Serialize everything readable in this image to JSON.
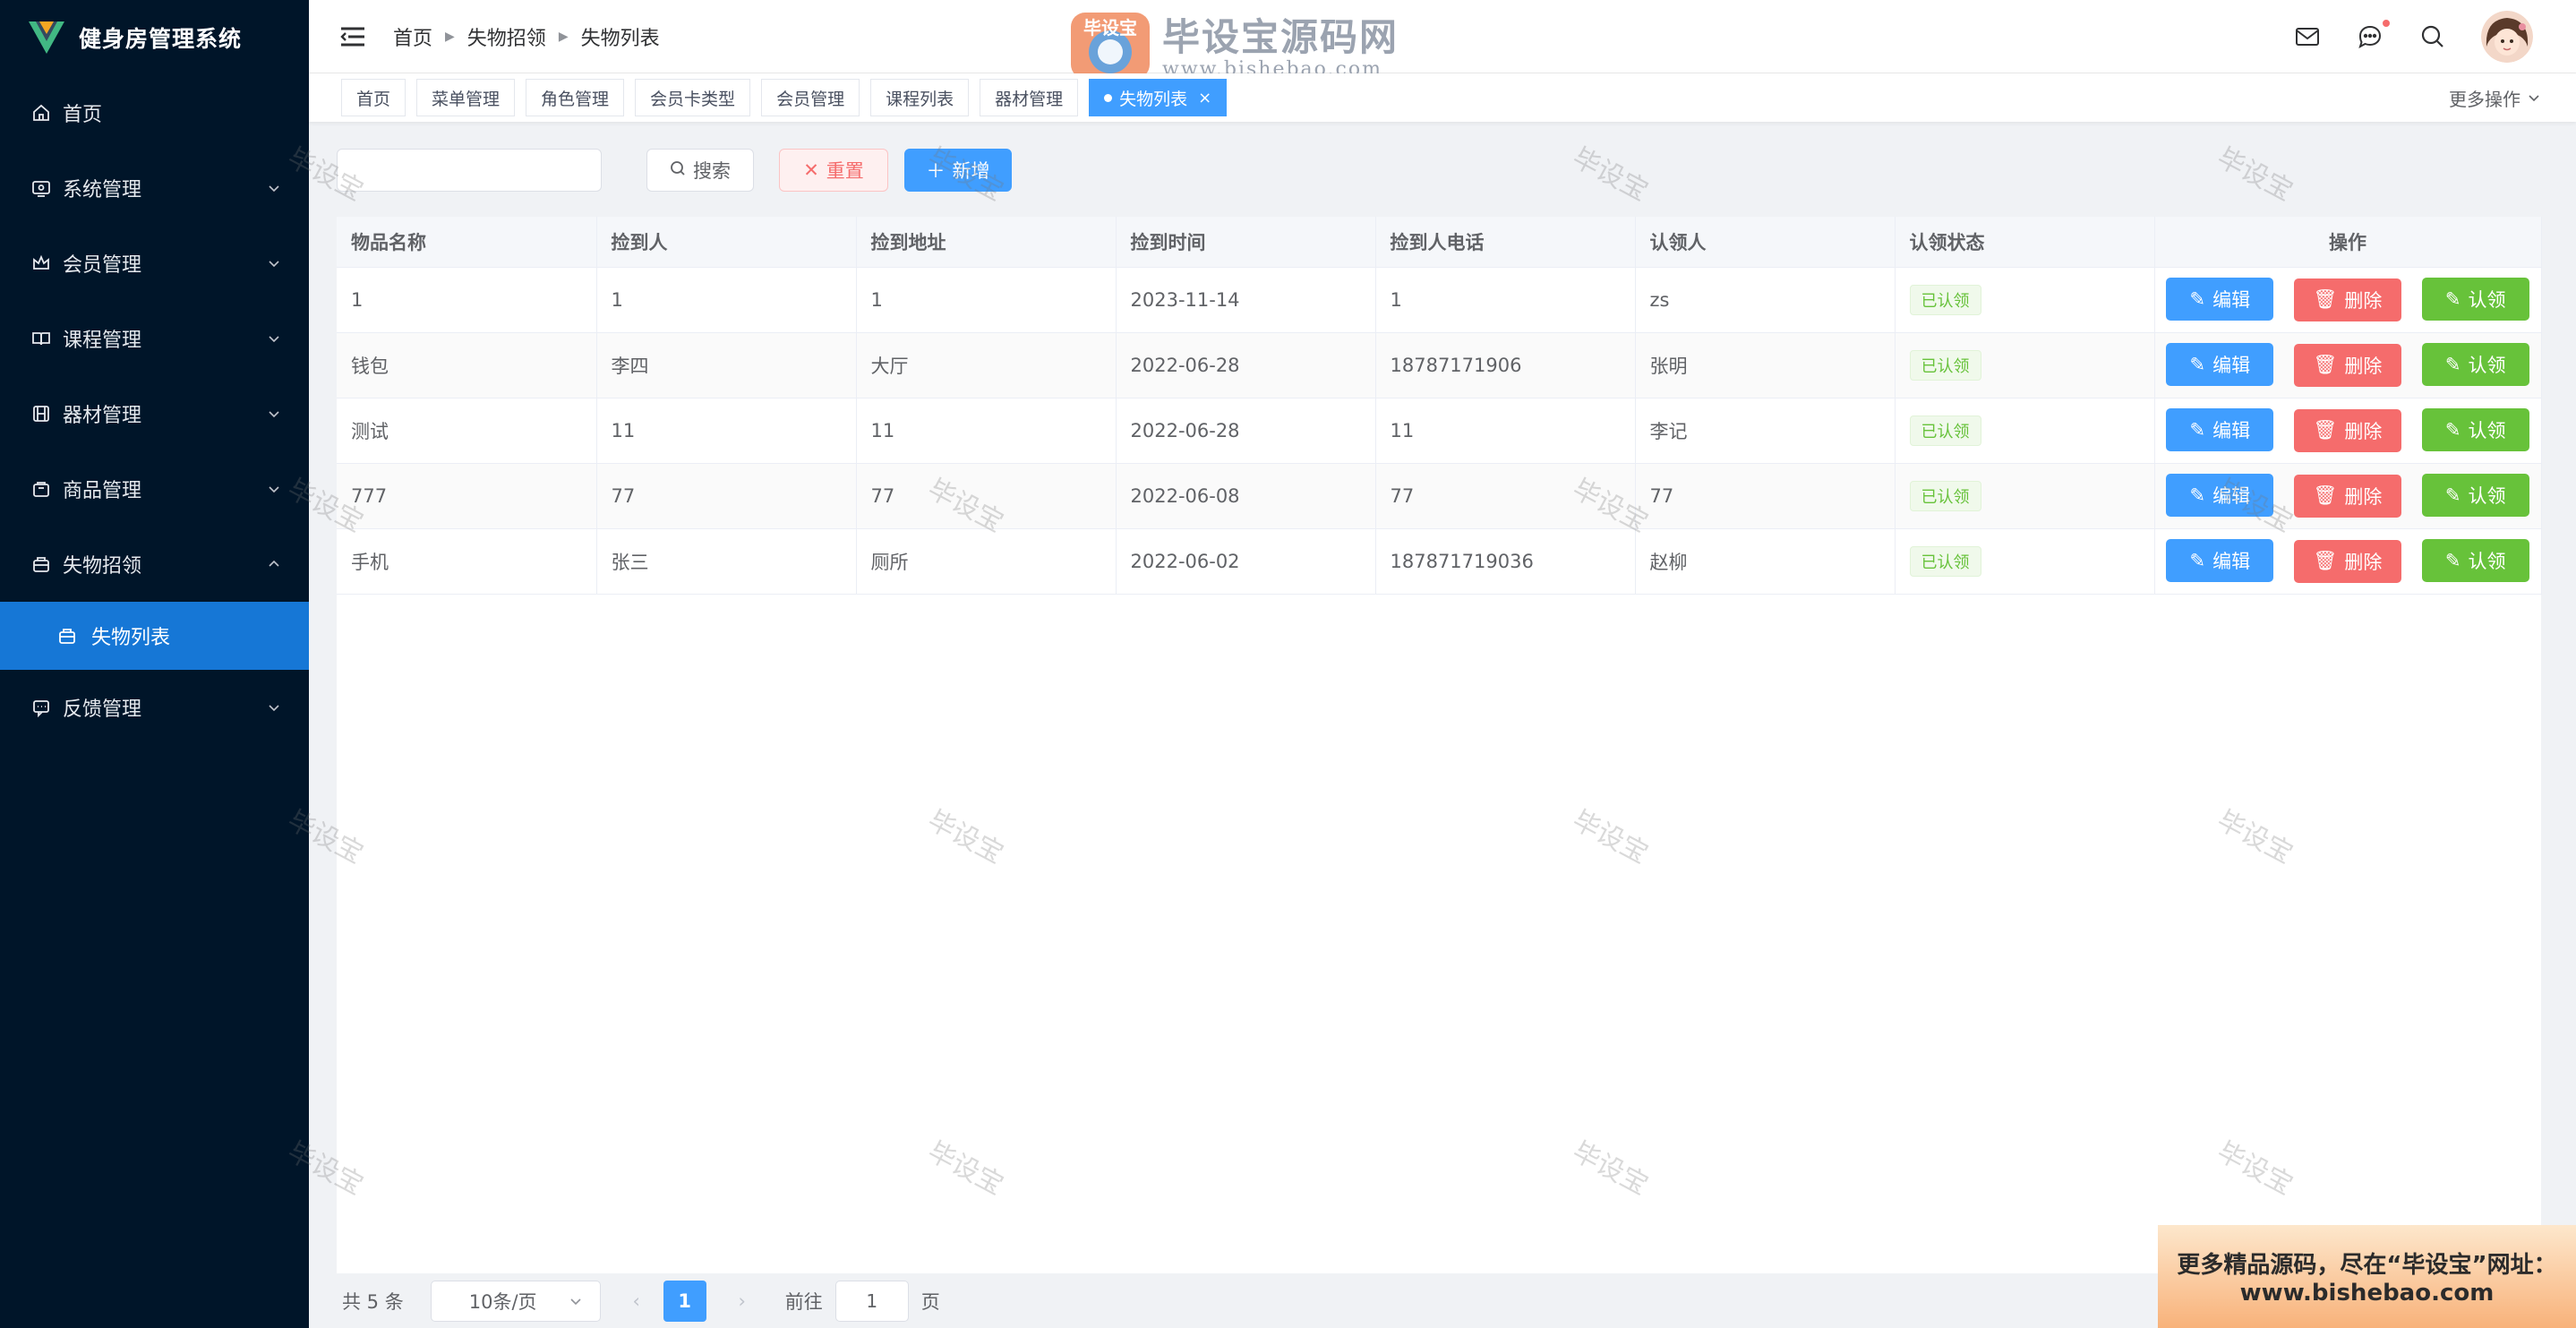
{
  "app": {
    "title": "健身房管理系统"
  },
  "sidebar": {
    "items": [
      {
        "label": "首页",
        "icon": "home-icon"
      },
      {
        "label": "系统管理",
        "icon": "system-icon"
      },
      {
        "label": "会员管理",
        "icon": "crown-icon"
      },
      {
        "label": "课程管理",
        "icon": "book-icon"
      },
      {
        "label": "器材管理",
        "icon": "equipment-icon"
      },
      {
        "label": "商品管理",
        "icon": "shop-icon"
      },
      {
        "label": "失物招领",
        "icon": "box-icon"
      },
      {
        "label": "反馈管理",
        "icon": "feedback-icon"
      }
    ],
    "submenu": {
      "label": "失物列表",
      "icon": "list-box-icon"
    }
  },
  "header": {
    "breadcrumb": [
      "首页",
      "失物招领",
      "失物列表"
    ]
  },
  "banner": {
    "text": "毕设宝源码网",
    "url": "www.bishebao.com",
    "logo_text": "毕设宝"
  },
  "tabs": {
    "items": [
      "首页",
      "菜单管理",
      "角色管理",
      "会员卡类型",
      "会员管理",
      "课程列表",
      "器材管理"
    ],
    "active": "失物列表",
    "more": "更多操作"
  },
  "toolbar": {
    "search_value": "",
    "search_label": "搜索",
    "reset_label": "重置",
    "add_label": "新增"
  },
  "table": {
    "columns": [
      "物品名称",
      "捡到人",
      "捡到地址",
      "捡到时间",
      "捡到人电话",
      "认领人",
      "认领状态",
      "操作"
    ],
    "rows": [
      {
        "name": "1",
        "finder": "1",
        "address": "1",
        "time": "2023-11-14",
        "phone": "1",
        "claimer": "zs",
        "status": "已认领"
      },
      {
        "name": "钱包",
        "finder": "李四",
        "address": "大厅",
        "time": "2022-06-28",
        "phone": "18787171906",
        "claimer": "张明",
        "status": "已认领"
      },
      {
        "name": "测试",
        "finder": "11",
        "address": "11",
        "time": "2022-06-28",
        "phone": "11",
        "claimer": "李记",
        "status": "已认领"
      },
      {
        "name": "777",
        "finder": "77",
        "address": "77",
        "time": "2022-06-08",
        "phone": "77",
        "claimer": "77",
        "status": "已认领"
      },
      {
        "name": "手机",
        "finder": "张三",
        "address": "厕所",
        "time": "2022-06-02",
        "phone": "187871719036",
        "claimer": "赵柳",
        "status": "已认领"
      }
    ],
    "actions": {
      "edit": "编辑",
      "delete": "删除",
      "claim": "认领"
    }
  },
  "pagination": {
    "total": "共 5 条",
    "page_size": "10条/页",
    "current": "1",
    "goto_prefix": "前往",
    "goto_value": "1",
    "goto_suffix": "页"
  },
  "watermark": "毕设宝",
  "promo": {
    "line1": "更多精品源码，尽在“毕设宝”网址：",
    "line2": "www.bishebao.com"
  },
  "colors": {
    "sidebar_bg": "#001529",
    "primary": "#409eff",
    "danger": "#f56c6c",
    "success": "#67c23a"
  }
}
